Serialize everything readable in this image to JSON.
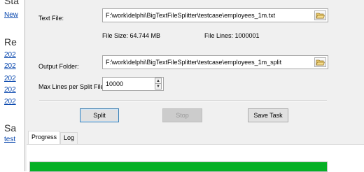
{
  "background_page": {
    "top_heading_cut": "Sta",
    "new_link": "New",
    "recent_heading": "Re",
    "recent_links": [
      "202",
      "202",
      "202",
      "202",
      "202"
    ],
    "saved_heading": "Sa",
    "saved_link": "test"
  },
  "form": {
    "text_file_label": "Text File:",
    "text_file_value": "F:\\work\\delphi\\BigTextFileSplitter\\testcase\\employees_1m.txt",
    "file_size": "File Size: 64.744 MB",
    "file_lines": "File Lines: 1000001",
    "output_folder_label": "Output Folder:",
    "output_folder_value": "F:\\work\\delphi\\BigTextFileSplitter\\testcase\\employees_1m_split",
    "max_lines_label": "Max Lines per Split File",
    "max_lines_value": "10000"
  },
  "buttons": {
    "split": "Split",
    "stop": "Stop",
    "save_task": "Save Task"
  },
  "tabs": [
    {
      "label": "Progress"
    },
    {
      "label": "Log"
    }
  ],
  "progress": {
    "value": 1.0,
    "color": "#06b025"
  },
  "icons": {
    "browse": "folder-open-icon",
    "spin_up": "spin-up-icon",
    "spin_down": "spin-down-icon"
  }
}
